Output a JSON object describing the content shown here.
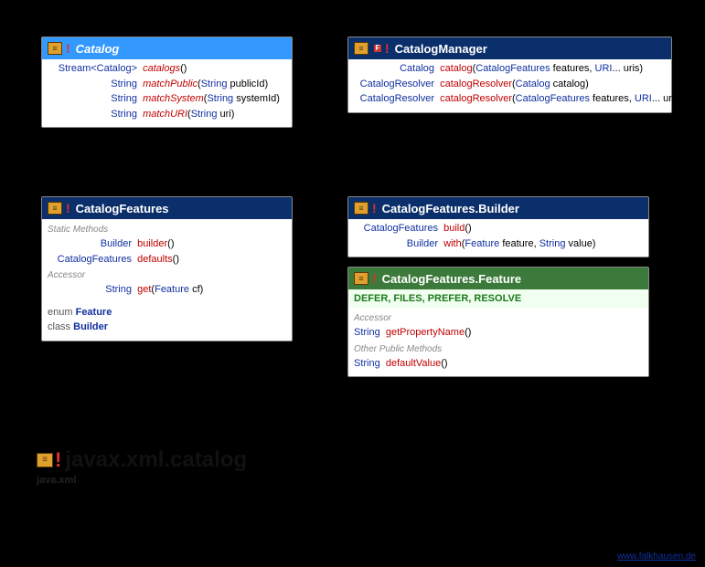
{
  "package": {
    "name": "javax.xml.catalog",
    "module": "java.xml"
  },
  "watermark": "www.falkhausen.de",
  "classes": {
    "catalog": {
      "name": "Catalog",
      "methods": [
        {
          "ret": "Stream<Catalog>",
          "name": "catalogs",
          "params": "()",
          "italic": true
        },
        {
          "ret": "String",
          "name": "matchPublic",
          "params_pre": "(",
          "params_type": "String",
          "params_name": " publicId)",
          "italic": true
        },
        {
          "ret": "String",
          "name": "matchSystem",
          "params_pre": "(",
          "params_type": "String",
          "params_name": " systemId)",
          "italic": true
        },
        {
          "ret": "String",
          "name": "matchURI",
          "params_pre": "(",
          "params_type": "String",
          "params_name": " uri)",
          "italic": true
        }
      ]
    },
    "catalogManager": {
      "name": "CatalogManager",
      "methods": [
        {
          "ret": "Catalog",
          "name": "catalog",
          "params_pre": "(",
          "params_type1": "CatalogFeatures",
          "params_mid": " features, ",
          "params_type2": "URI",
          "params_tail": "... uris)"
        },
        {
          "ret": "CatalogResolver",
          "name": "catalogResolver",
          "params_pre": "(",
          "params_type1": "Catalog",
          "params_tail": " catalog)"
        },
        {
          "ret": "CatalogResolver",
          "name": "catalogResolver",
          "params_pre": "(",
          "params_type1": "CatalogFeatures",
          "params_mid": " features, ",
          "params_type2": "URI",
          "params_tail": "... uris)"
        }
      ]
    },
    "catalogFeatures": {
      "name": "CatalogFeatures",
      "static_label": "Static Methods",
      "static_methods": [
        {
          "ret": "Builder",
          "name": "builder",
          "params": "()"
        },
        {
          "ret": "CatalogFeatures",
          "name": "defaults",
          "params": "()"
        }
      ],
      "accessor_label": "Accessor",
      "accessors": [
        {
          "ret": "String",
          "name": "get",
          "params_pre": "(",
          "params_type": "Feature",
          "params_name": " cf)"
        }
      ],
      "nested": [
        {
          "kind": "enum",
          "name": "Feature"
        },
        {
          "kind": "class",
          "name": "Builder"
        }
      ]
    },
    "builder": {
      "name": "CatalogFeatures.Builder",
      "methods": [
        {
          "ret": "CatalogFeatures",
          "name": "build",
          "params": "()"
        },
        {
          "ret": "Builder",
          "name": "with",
          "params_pre": "(",
          "params_type1": "Feature",
          "params_mid": " feature, ",
          "params_type2": "String",
          "params_tail": " value)"
        }
      ]
    },
    "feature": {
      "name": "CatalogFeatures.Feature",
      "constants": "DEFER, FILES, PREFER, RESOLVE",
      "accessor_label": "Accessor",
      "accessors": [
        {
          "ret": "String",
          "name": "getPropertyName",
          "params": "()"
        }
      ],
      "other_label": "Other Public Methods",
      "others": [
        {
          "ret": "String",
          "name": "defaultValue",
          "params": "()"
        }
      ]
    }
  }
}
